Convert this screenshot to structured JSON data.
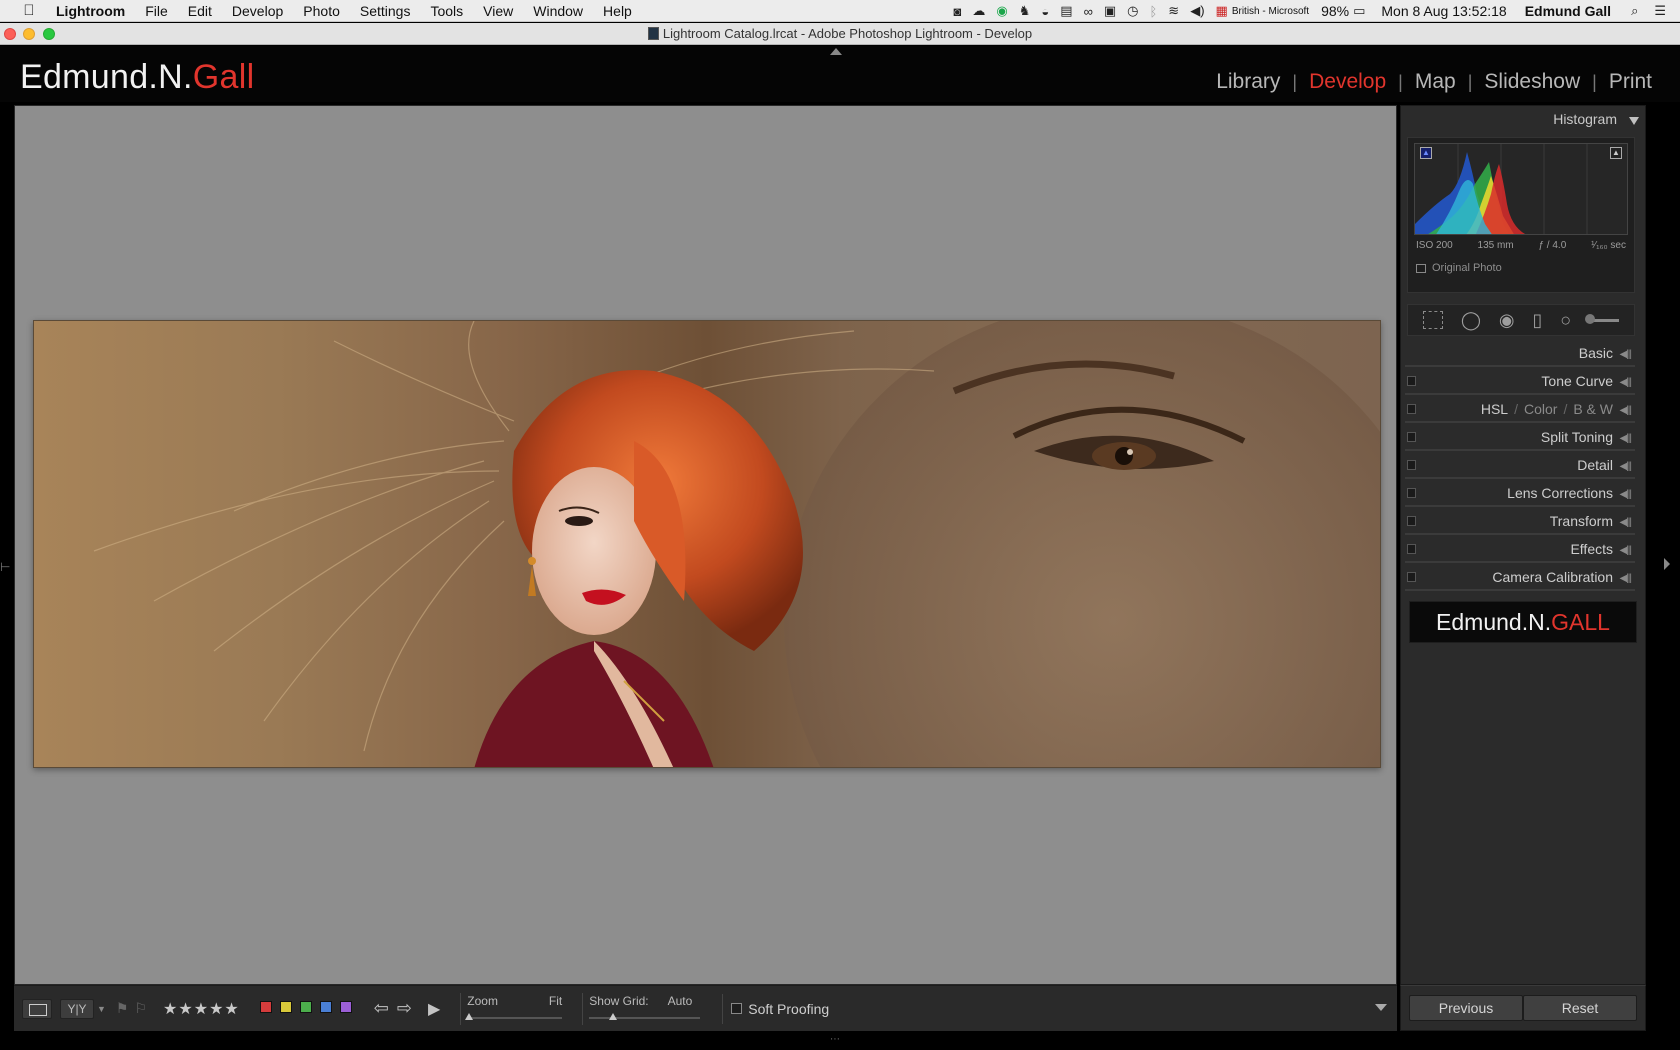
{
  "menubar": {
    "app": "Lightroom",
    "items": [
      "File",
      "Edit",
      "Develop",
      "Photo",
      "Settings",
      "Tools",
      "View",
      "Window",
      "Help"
    ],
    "keyboard": "British - Microsoft",
    "battery": "98%",
    "datetime": "Mon 8 Aug  13:52:18",
    "user": "Edmund Gall"
  },
  "window": {
    "title": "Lightroom Catalog.lrcat - Adobe Photoshop Lightroom - Develop"
  },
  "identity": {
    "name_main": "Edmund.N.",
    "name_accent": "Gall"
  },
  "modules": {
    "library": "Library",
    "develop": "Develop",
    "map": "Map",
    "slideshow": "Slideshow",
    "print": "Print",
    "active": "Develop"
  },
  "histogram": {
    "title": "Histogram",
    "iso": "ISO 200",
    "focal": "135 mm",
    "aperture": "ƒ / 4.0",
    "shutter": "¹⁄₁₆₀ sec",
    "original_photo": "Original Photo"
  },
  "panels": {
    "basic": "Basic",
    "tone_curve": "Tone Curve",
    "hsl": "HSL",
    "color": "Color",
    "bw": "B & W",
    "split_toning": "Split Toning",
    "detail": "Detail",
    "lens_corrections": "Lens Corrections",
    "transform": "Transform",
    "effects": "Effects",
    "camera_calibration": "Camera Calibration"
  },
  "watermark": {
    "main": "Edmund.N.",
    "accent": "GALL"
  },
  "toolbar": {
    "compare_label": "Y|Y",
    "stars": "★★★★★",
    "zoom_label": "Zoom",
    "zoom_value": "Fit",
    "grid_label": "Show Grid:",
    "grid_value": "Auto",
    "soft_proofing": "Soft Proofing",
    "label_colors": [
      "#d43c3c",
      "#d8c83a",
      "#4cae4c",
      "#4a7fd4",
      "#9b5fd6"
    ]
  },
  "footer": {
    "previous": "Previous",
    "reset": "Reset"
  },
  "icons": {
    "apple": "apple-icon",
    "spotlight": "search-icon",
    "notification": "list-icon"
  }
}
